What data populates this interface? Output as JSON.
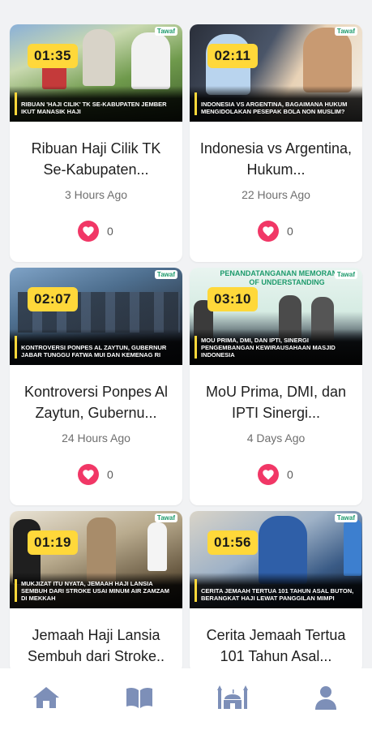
{
  "cards": [
    {
      "duration": "01:35",
      "caption": "Ribuan 'Haji Cilik' TK Se-Kabupaten Jember Ikut Manasik Haji",
      "title": "Ribuan Haji Cilik TK Se-Kabupaten...",
      "time": "3 Hours Ago",
      "likes": "0",
      "brand": "Tawaf"
    },
    {
      "duration": "02:11",
      "caption": "Indonesia vs Argentina, Bagaimana Hukum Mengidolakan Pesepak Bola Non Muslim?",
      "title": "Indonesia vs Argentina, Hukum...",
      "time": "22 Hours Ago",
      "likes": "0",
      "brand": "Tawaf"
    },
    {
      "duration": "02:07",
      "caption": "Kontroversi Ponpes Al Zaytun, Gubernur Jabar Tunggu Fatwa MUI dan Kemenag RI",
      "title": "Kontroversi Ponpes Al Zaytun, Gubernu...",
      "time": "24 Hours Ago",
      "likes": "0",
      "brand": "Tawaf"
    },
    {
      "duration": "03:10",
      "caption": "MoU Prima, DMI, dan IPTI, Sinergi Pengembangan Kewirausahaan Masjid Indonesia",
      "title": "MoU Prima, DMI, dan IPTI Sinergi...",
      "time": "4 Days Ago",
      "likes": "0",
      "brand": "Tawaf",
      "banner": "PENANDATANGANAN MEMORANDUM OF UNDERSTANDING"
    },
    {
      "duration": "01:19",
      "caption": "Mukjizat Itu Nyata, Jemaah Haji Lansia Sembuh dari Stroke Usai Minum Air Zamzam di Mekkah",
      "title": "Jemaah Haji Lansia Sembuh dari Stroke..",
      "time": "",
      "likes": "",
      "brand": "Tawaf"
    },
    {
      "duration": "01:56",
      "caption": "Cerita Jemaah Tertua 101 Tahun Asal Buton, Berangkat Haji Lewat Panggilan Mimpi",
      "title": "Cerita Jemaah Tertua 101 Tahun Asal...",
      "time": "",
      "likes": "",
      "brand": "Tawaf"
    }
  ],
  "nav": {
    "home": "home-icon",
    "quran": "book-icon",
    "mosque": "mosque-icon",
    "profile": "user-icon"
  },
  "colors": {
    "accent": "#ffd83a",
    "heart": "#f13766",
    "nav_icon": "#7d8fb8"
  }
}
